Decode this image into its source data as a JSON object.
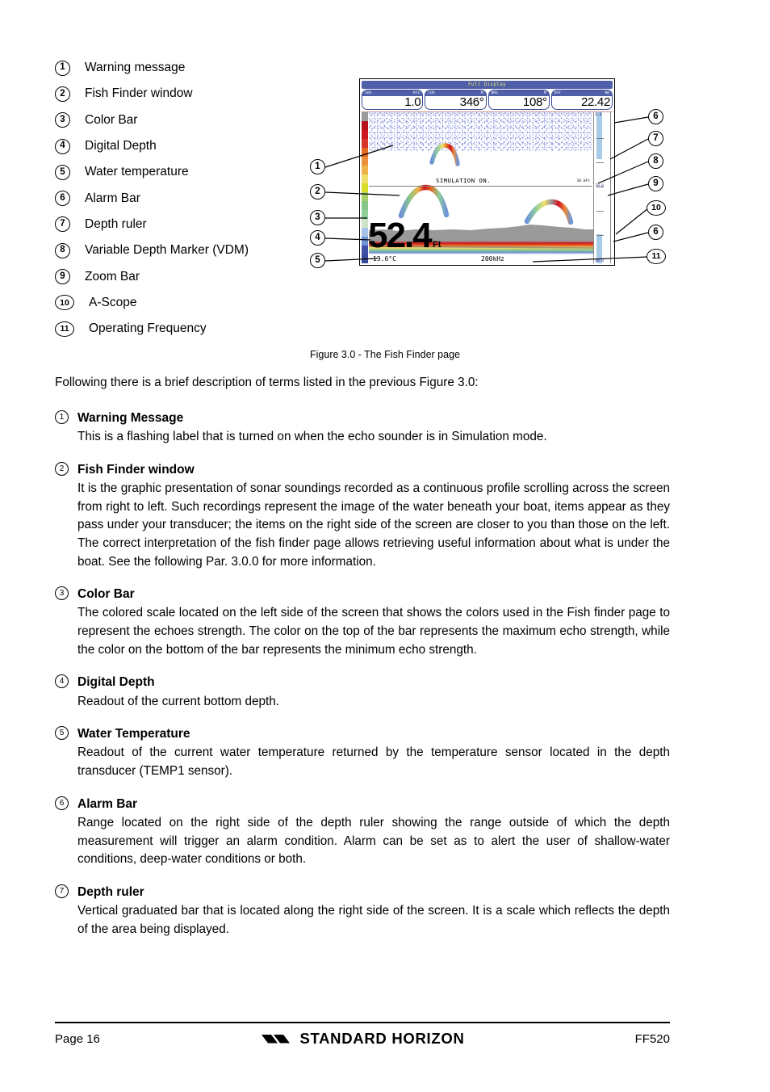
{
  "legend": {
    "items": [
      {
        "num": "1",
        "label": "Warning message"
      },
      {
        "num": "2",
        "label": "Fish Finder window"
      },
      {
        "num": "3",
        "label": "Color Bar"
      },
      {
        "num": "4",
        "label": "Digital Depth"
      },
      {
        "num": "5",
        "label": "Water temperature"
      },
      {
        "num": "6",
        "label": "Alarm Bar"
      },
      {
        "num": "7",
        "label": "Depth ruler"
      },
      {
        "num": "8",
        "label": "Variable Depth Marker (VDM)"
      },
      {
        "num": "9",
        "label": "Zoom Bar"
      },
      {
        "num": "10",
        "label": "A-Scope"
      },
      {
        "num": "11",
        "label": "Operating Frequency"
      }
    ]
  },
  "device": {
    "title": "Full Display",
    "data_cells": [
      {
        "label": "SOG",
        "unit": "Kts",
        "value": "1.0"
      },
      {
        "label": "COG",
        "unit": "M",
        "value": "346°"
      },
      {
        "label": "BRG",
        "unit": "M",
        "value": "108°"
      },
      {
        "label": "DST",
        "unit": "Nm",
        "value": "22.42"
      }
    ],
    "warning_text": "SIMULATION ON.",
    "vdm_value": "30.0Ft",
    "depth_value": "52.4",
    "depth_unit": "Ft",
    "temperature": "19.6°C",
    "frequency": "200kHz",
    "ruler_labels": [
      "0.0",
      "30.0",
      "60.0"
    ],
    "color_bar_colors": [
      "#9a9a9a",
      "#b5121b",
      "#cf1320",
      "#d8352c",
      "#e36a1e",
      "#ea8f3a",
      "#eeb34a",
      "#f2de6a",
      "#d8dd2a",
      "#a8cf6e",
      "#86c68a",
      "#8fcf9a",
      "#cfe3c8",
      "#a8c3e8",
      "#6f93d8",
      "#4050a8",
      "#3a4a9a"
    ],
    "alarm_bar_color": "#a8cbe8",
    "ruler_border_color": "#8a8a8a"
  },
  "callouts": {
    "left": [
      "1",
      "2",
      "3",
      "4",
      "5"
    ],
    "right": [
      "6",
      "7",
      "8",
      "9",
      "10",
      "6",
      "11"
    ]
  },
  "figure": {
    "caption": "Figure  3.0 - The Fish Finder page"
  },
  "intro": "Following there is a brief description of terms listed in the previous Figure 3.0:",
  "terms": [
    {
      "num": "1",
      "title": "Warning Message",
      "body": "This is a flashing label that is turned on when the echo sounder is in Simulation mode."
    },
    {
      "num": "2",
      "title": "Fish Finder window",
      "body": "It is the graphic presentation of sonar soundings recorded as a continuous profile scrolling across the screen from right to left. Such recordings represent the image of the water beneath your boat, items appear as they pass under your transducer; the items on the right side of the screen are closer to you than those on the left. The correct interpretation of the fish finder page allows retrieving useful information about what is under the boat.  See the following Par. 3.0.0 for more information."
    },
    {
      "num": "3",
      "title": "Color Bar",
      "body": "The colored scale located on the left side of the screen that shows the colors used in the Fish finder page to represent the echoes strength. The color on the top of the bar represents the maximum echo strength, while the color on the bottom of the bar represents the minimum echo strength."
    },
    {
      "num": "4",
      "title": "Digital Depth",
      "body": "Readout of the current bottom depth."
    },
    {
      "num": "5",
      "title": "Water Temperature",
      "body": "Readout of the current water temperature returned by the temperature sensor located in the depth transducer (TEMP1 sensor)."
    },
    {
      "num": "6",
      "title": "Alarm Bar",
      "body": "Range located on the right side of the depth ruler showing the range outside of which the depth measurement will trigger an alarm condition. Alarm can be set as to alert the user of shallow-water conditions, deep-water conditions or both."
    },
    {
      "num": "7",
      "title": "Depth ruler",
      "body": "Vertical graduated bar that is located along the right side of the screen. It  is a scale which reflects the depth of the area being displayed."
    }
  ],
  "footer": {
    "page": "Page  16",
    "brand": "STANDARD HORIZON",
    "model": "FF520"
  }
}
